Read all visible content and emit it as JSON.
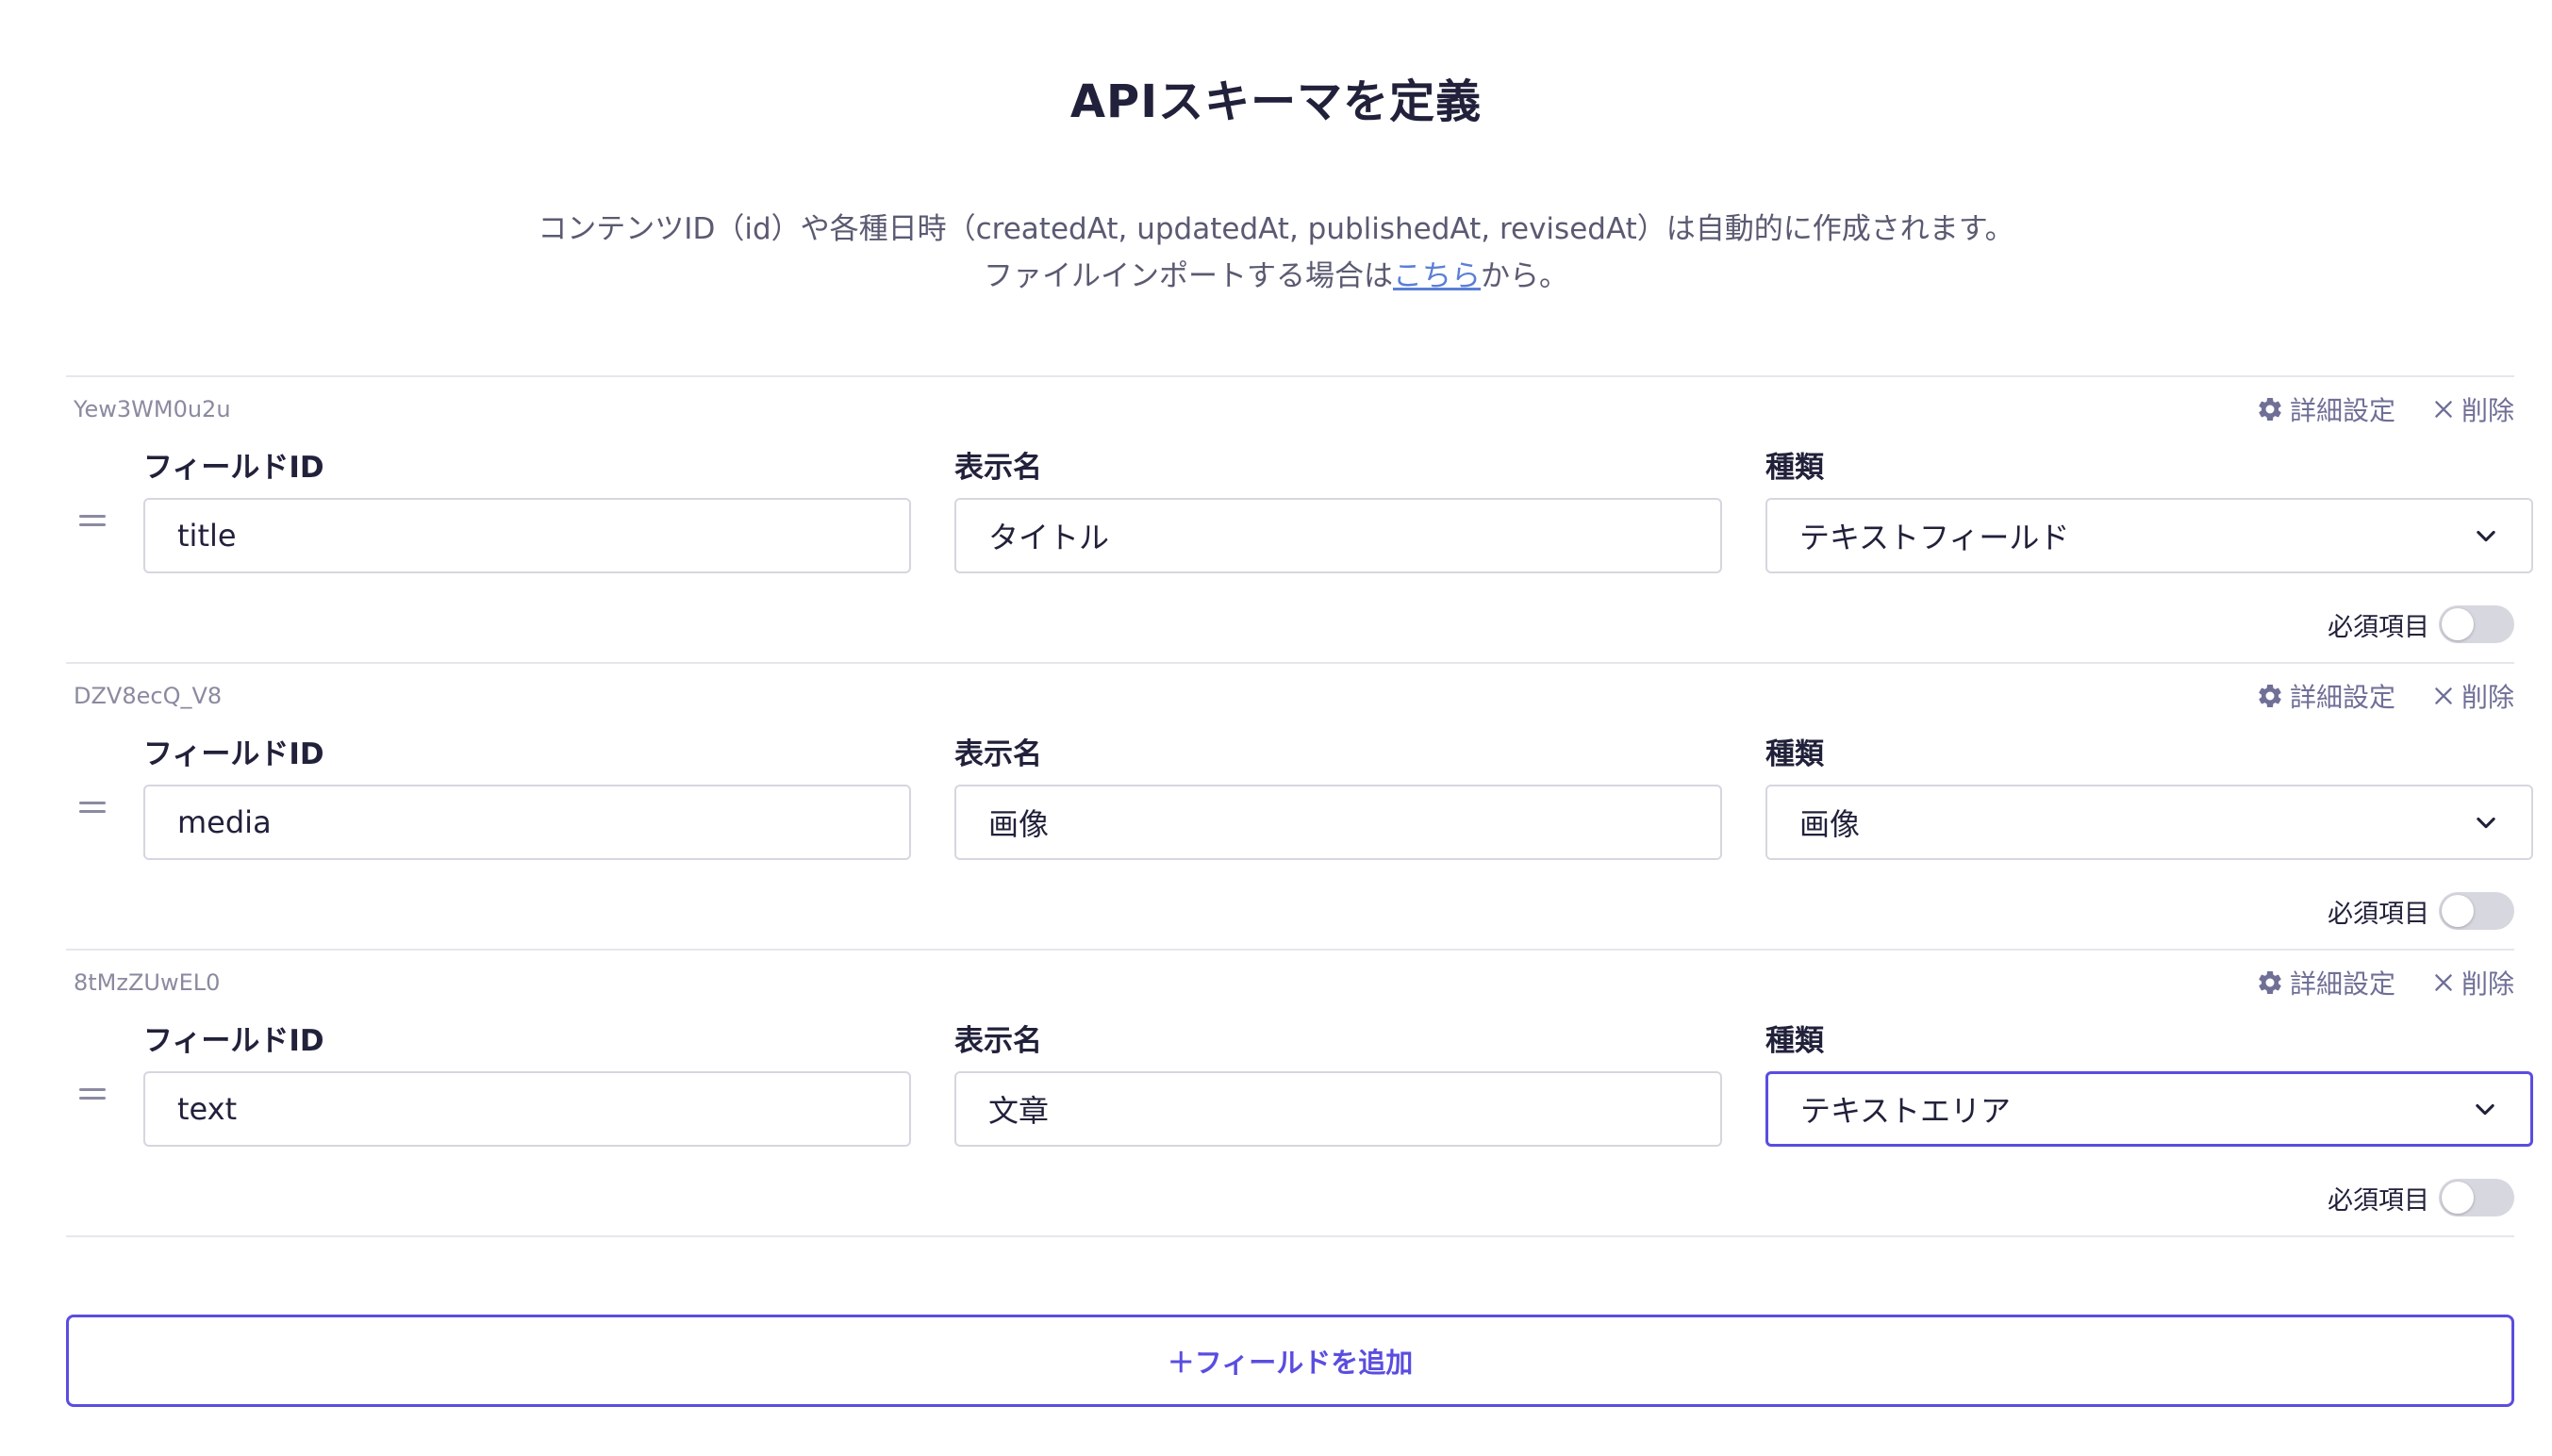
{
  "page": {
    "title": "APIスキーマを定義",
    "description_line1": "コンテンツID（id）や各種日時（createdAt, updatedAt, publishedAt, revisedAt）は自動的に作成されます。",
    "description_line2_before": "ファイルインポートする場合は",
    "description_link": "こちら",
    "description_line2_after": "から。"
  },
  "labels": {
    "field_id": "フィールドID",
    "display_name": "表示名",
    "type": "種類",
    "settings": "詳細設定",
    "delete": "削除",
    "required": "必須項目"
  },
  "fields": [
    {
      "uid": "Yew3WM0u2u",
      "field_id": "title",
      "display_name": "タイトル",
      "type": "テキストフィールド",
      "required": false
    },
    {
      "uid": "DZV8ecQ_V8",
      "field_id": "media",
      "display_name": "画像",
      "type": "画像",
      "required": false
    },
    {
      "uid": "8tMzZUwEL0",
      "field_id": "text",
      "display_name": "文章",
      "type": "テキストエリア",
      "required": false
    }
  ],
  "add_button": "＋フィールドを追加",
  "colors": {
    "accent": "#5a4de0",
    "muted": "#6f6f97",
    "link": "#5b7fd6"
  },
  "icons": {
    "settings": "gear-icon",
    "delete": "close-icon",
    "drag": "drag-handle-icon",
    "dropdown": "chevron-down-icon"
  }
}
